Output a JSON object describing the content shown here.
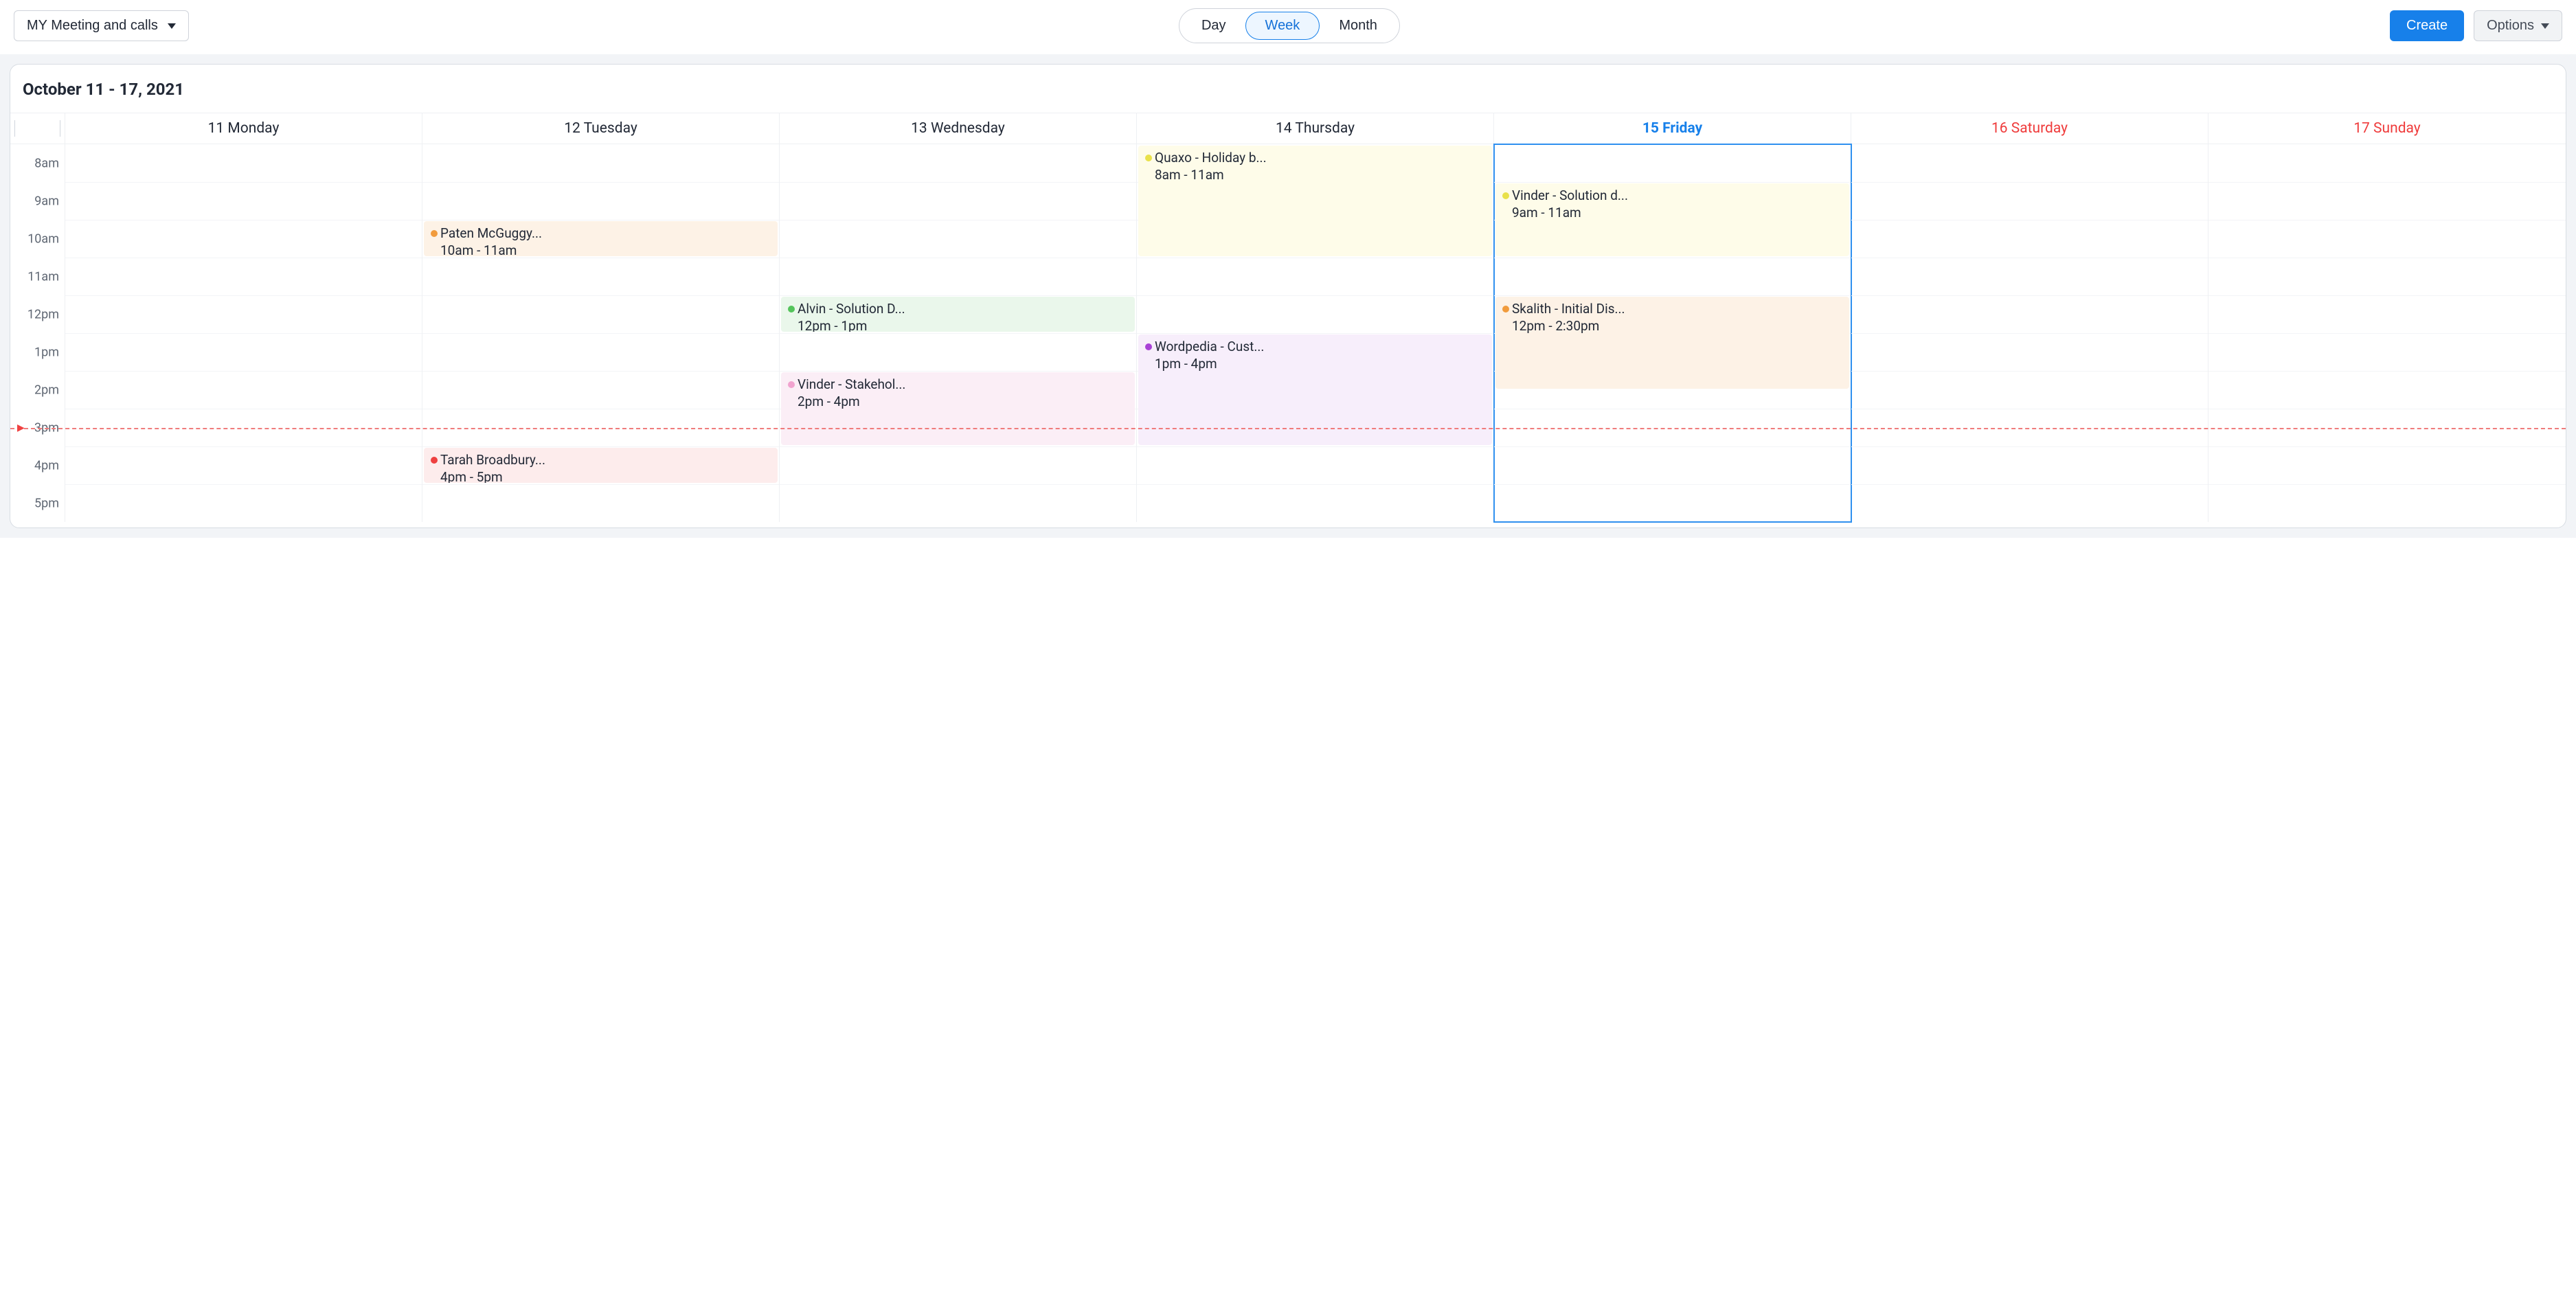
{
  "toolbar": {
    "filter_label": "MY Meeting and calls",
    "views": {
      "day": "Day",
      "week": "Week",
      "month": "Month"
    },
    "active_view": "week",
    "create_label": "Create",
    "options_label": "Options"
  },
  "calendar": {
    "range_title": "October 11 - 17, 2021",
    "grid": {
      "start_hour_index": 0,
      "hour_height": 55,
      "hours": [
        "8am",
        "9am",
        "10am",
        "11am",
        "12pm",
        "1pm",
        "2pm",
        "3pm",
        "4pm",
        "5pm"
      ],
      "now_hour_index": 7
    },
    "days": [
      {
        "label": "11 Monday",
        "current": false,
        "weekend": false
      },
      {
        "label": "12 Tuesday",
        "current": false,
        "weekend": false
      },
      {
        "label": "13 Wednesday",
        "current": false,
        "weekend": false
      },
      {
        "label": "14 Thursday",
        "current": false,
        "weekend": false
      },
      {
        "label": "15 Friday",
        "current": true,
        "weekend": false
      },
      {
        "label": "16 Saturday",
        "current": false,
        "weekend": true
      },
      {
        "label": "17 Sunday",
        "current": false,
        "weekend": true
      }
    ],
    "events": [
      {
        "day": 3,
        "title": "Quaxo - Holiday b...",
        "time": "8am - 11am",
        "start": 0,
        "dur": 3,
        "color": "yellow"
      },
      {
        "day": 4,
        "title": "Vinder - Solution d...",
        "time": "9am - 11am",
        "start": 1,
        "dur": 2,
        "color": "yellow"
      },
      {
        "day": 1,
        "title": "Paten McGuggy...",
        "time": "10am - 11am",
        "start": 2,
        "dur": 1,
        "color": "orange"
      },
      {
        "day": 2,
        "title": "Alvin - Solution D...",
        "time": "12pm - 1pm",
        "start": 4,
        "dur": 1,
        "color": "green"
      },
      {
        "day": 4,
        "title": "Skalith - Initial Dis...",
        "time": "12pm - 2:30pm",
        "start": 4,
        "dur": 2.5,
        "color": "orange"
      },
      {
        "day": 3,
        "title": "Wordpedia - Cust...",
        "time": "1pm - 4pm",
        "start": 5,
        "dur": 3,
        "color": "purple"
      },
      {
        "day": 2,
        "title": "Vinder - Stakehol...",
        "time": "2pm - 4pm",
        "start": 6,
        "dur": 2,
        "color": "pink"
      },
      {
        "day": 1,
        "title": "Tarah Broadbury...",
        "time": "4pm - 5pm",
        "start": 8,
        "dur": 1,
        "color": "red"
      }
    ]
  }
}
